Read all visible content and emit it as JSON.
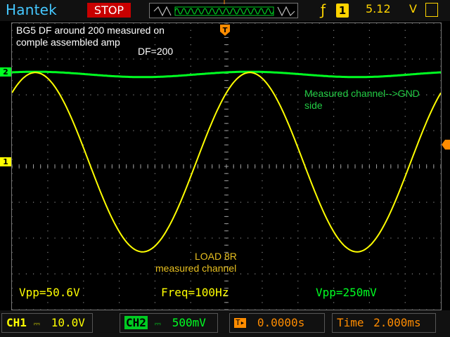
{
  "top_bar": {
    "brand": "Hantek",
    "run_state": "STOP",
    "trigger": {
      "edge_icon": "rising-edge-icon",
      "source": "1",
      "level": "5.12",
      "unit": "V"
    },
    "trigger_position_marker": "T"
  },
  "annotations": {
    "title_line1": "BG5 DF around 200 measured on",
    "title_line2": "comple assembled amp",
    "df_label": "DF=200",
    "ch2_note_line1": "Measured channel-->GND",
    "ch2_note_line2": "side",
    "ch1_note_line1": "LOAD 8R",
    "ch1_note_line2": "measured channel"
  },
  "measurements": {
    "ch1_vpp": "Vpp=50.6V",
    "freq": "Freq=100Hz",
    "ch2_vpp": "Vpp=250mV"
  },
  "channels": {
    "ch1": {
      "label": "CH1",
      "coupling_icon": "dc-coupling-icon",
      "scale": "10.0V",
      "marker": "1",
      "color": "#ffff00"
    },
    "ch2": {
      "label": "CH2",
      "coupling_icon": "dc-coupling-icon",
      "scale": "500mV",
      "marker": "2",
      "color": "#00ff22"
    }
  },
  "horizontal": {
    "trigger_offset": "0.0000s",
    "time_label": "Time",
    "timebase": "2.000ms"
  },
  "waveforms": {
    "ch1": {
      "shape": "sine",
      "cycles_on_screen": 2,
      "vpp_divisions": 5.06
    },
    "ch2": {
      "shape": "sine",
      "cycles_on_screen": 2,
      "vpp_divisions": 0.5
    }
  },
  "colors": {
    "ch1": "#ffff00",
    "ch2": "#00ff22",
    "brand": "#45c8ff",
    "stop": "#c80000",
    "trigger_marker": "#ff8c00"
  }
}
